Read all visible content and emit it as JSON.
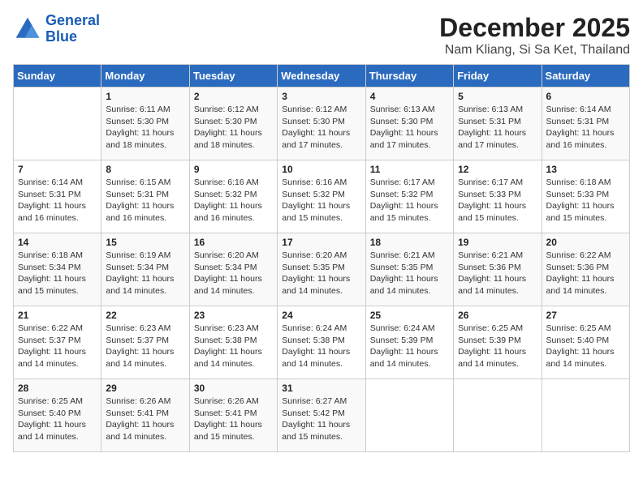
{
  "header": {
    "logo_line1": "General",
    "logo_line2": "Blue",
    "month": "December 2025",
    "location": "Nam Kliang, Si Sa Ket, Thailand"
  },
  "weekdays": [
    "Sunday",
    "Monday",
    "Tuesday",
    "Wednesday",
    "Thursday",
    "Friday",
    "Saturday"
  ],
  "weeks": [
    [
      {
        "day": "",
        "info": ""
      },
      {
        "day": "1",
        "info": "Sunrise: 6:11 AM\nSunset: 5:30 PM\nDaylight: 11 hours\nand 18 minutes."
      },
      {
        "day": "2",
        "info": "Sunrise: 6:12 AM\nSunset: 5:30 PM\nDaylight: 11 hours\nand 18 minutes."
      },
      {
        "day": "3",
        "info": "Sunrise: 6:12 AM\nSunset: 5:30 PM\nDaylight: 11 hours\nand 17 minutes."
      },
      {
        "day": "4",
        "info": "Sunrise: 6:13 AM\nSunset: 5:30 PM\nDaylight: 11 hours\nand 17 minutes."
      },
      {
        "day": "5",
        "info": "Sunrise: 6:13 AM\nSunset: 5:31 PM\nDaylight: 11 hours\nand 17 minutes."
      },
      {
        "day": "6",
        "info": "Sunrise: 6:14 AM\nSunset: 5:31 PM\nDaylight: 11 hours\nand 16 minutes."
      }
    ],
    [
      {
        "day": "7",
        "info": "Sunrise: 6:14 AM\nSunset: 5:31 PM\nDaylight: 11 hours\nand 16 minutes."
      },
      {
        "day": "8",
        "info": "Sunrise: 6:15 AM\nSunset: 5:31 PM\nDaylight: 11 hours\nand 16 minutes."
      },
      {
        "day": "9",
        "info": "Sunrise: 6:16 AM\nSunset: 5:32 PM\nDaylight: 11 hours\nand 16 minutes."
      },
      {
        "day": "10",
        "info": "Sunrise: 6:16 AM\nSunset: 5:32 PM\nDaylight: 11 hours\nand 15 minutes."
      },
      {
        "day": "11",
        "info": "Sunrise: 6:17 AM\nSunset: 5:32 PM\nDaylight: 11 hours\nand 15 minutes."
      },
      {
        "day": "12",
        "info": "Sunrise: 6:17 AM\nSunset: 5:33 PM\nDaylight: 11 hours\nand 15 minutes."
      },
      {
        "day": "13",
        "info": "Sunrise: 6:18 AM\nSunset: 5:33 PM\nDaylight: 11 hours\nand 15 minutes."
      }
    ],
    [
      {
        "day": "14",
        "info": "Sunrise: 6:18 AM\nSunset: 5:34 PM\nDaylight: 11 hours\nand 15 minutes."
      },
      {
        "day": "15",
        "info": "Sunrise: 6:19 AM\nSunset: 5:34 PM\nDaylight: 11 hours\nand 14 minutes."
      },
      {
        "day": "16",
        "info": "Sunrise: 6:20 AM\nSunset: 5:34 PM\nDaylight: 11 hours\nand 14 minutes."
      },
      {
        "day": "17",
        "info": "Sunrise: 6:20 AM\nSunset: 5:35 PM\nDaylight: 11 hours\nand 14 minutes."
      },
      {
        "day": "18",
        "info": "Sunrise: 6:21 AM\nSunset: 5:35 PM\nDaylight: 11 hours\nand 14 minutes."
      },
      {
        "day": "19",
        "info": "Sunrise: 6:21 AM\nSunset: 5:36 PM\nDaylight: 11 hours\nand 14 minutes."
      },
      {
        "day": "20",
        "info": "Sunrise: 6:22 AM\nSunset: 5:36 PM\nDaylight: 11 hours\nand 14 minutes."
      }
    ],
    [
      {
        "day": "21",
        "info": "Sunrise: 6:22 AM\nSunset: 5:37 PM\nDaylight: 11 hours\nand 14 minutes."
      },
      {
        "day": "22",
        "info": "Sunrise: 6:23 AM\nSunset: 5:37 PM\nDaylight: 11 hours\nand 14 minutes."
      },
      {
        "day": "23",
        "info": "Sunrise: 6:23 AM\nSunset: 5:38 PM\nDaylight: 11 hours\nand 14 minutes."
      },
      {
        "day": "24",
        "info": "Sunrise: 6:24 AM\nSunset: 5:38 PM\nDaylight: 11 hours\nand 14 minutes."
      },
      {
        "day": "25",
        "info": "Sunrise: 6:24 AM\nSunset: 5:39 PM\nDaylight: 11 hours\nand 14 minutes."
      },
      {
        "day": "26",
        "info": "Sunrise: 6:25 AM\nSunset: 5:39 PM\nDaylight: 11 hours\nand 14 minutes."
      },
      {
        "day": "27",
        "info": "Sunrise: 6:25 AM\nSunset: 5:40 PM\nDaylight: 11 hours\nand 14 minutes."
      }
    ],
    [
      {
        "day": "28",
        "info": "Sunrise: 6:25 AM\nSunset: 5:40 PM\nDaylight: 11 hours\nand 14 minutes."
      },
      {
        "day": "29",
        "info": "Sunrise: 6:26 AM\nSunset: 5:41 PM\nDaylight: 11 hours\nand 14 minutes."
      },
      {
        "day": "30",
        "info": "Sunrise: 6:26 AM\nSunset: 5:41 PM\nDaylight: 11 hours\nand 15 minutes."
      },
      {
        "day": "31",
        "info": "Sunrise: 6:27 AM\nSunset: 5:42 PM\nDaylight: 11 hours\nand 15 minutes."
      },
      {
        "day": "",
        "info": ""
      },
      {
        "day": "",
        "info": ""
      },
      {
        "day": "",
        "info": ""
      }
    ]
  ]
}
